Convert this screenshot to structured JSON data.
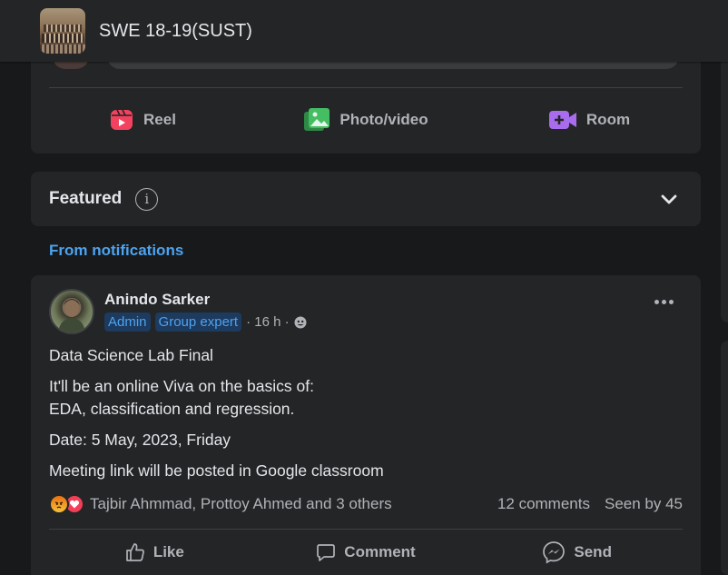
{
  "header": {
    "group_name": "SWE 18-19(SUST)"
  },
  "composer": {
    "actions": [
      {
        "label": "Reel",
        "icon": "reel-icon",
        "color": "#f3425f"
      },
      {
        "label": "Photo/video",
        "icon": "photo-icon",
        "color": "#45bd62"
      },
      {
        "label": "Room",
        "icon": "video-room-icon",
        "color": "#a86ced"
      }
    ]
  },
  "featured": {
    "title": "Featured",
    "info_glyph": "i"
  },
  "section_label": "From notifications",
  "post": {
    "author": "Anindo Sarker",
    "badges": [
      "Admin",
      "Group expert"
    ],
    "time": "· 16 h ·",
    "paragraphs": [
      "Data Science Lab Final",
      "It'll be an online Viva on the basics of:",
      "EDA, classification and regression.",
      "Date: 5 May, 2023, Friday",
      "Meeting link will be posted in Google classroom"
    ],
    "reactions_text": "Tajbir Ahmmad, Prottoy Ahmed and 3 others",
    "comments": "12 comments",
    "seen": "Seen by 45",
    "actions": [
      {
        "label": "Like",
        "icon": "like-icon"
      },
      {
        "label": "Comment",
        "icon": "comment-icon"
      },
      {
        "label": "Send",
        "icon": "messenger-icon"
      }
    ]
  },
  "colors": {
    "background": "#18191a",
    "card": "#242526",
    "link": "#4da3ef",
    "muted": "#b0b3b8"
  }
}
